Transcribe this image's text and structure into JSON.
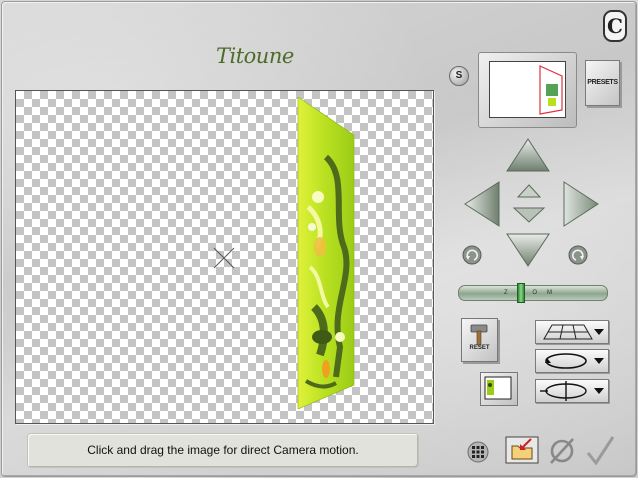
{
  "window": {
    "title": "Titoune",
    "logo_letter": "C"
  },
  "preview": {
    "status_text": "Click and drag the image for direct Camera motion."
  },
  "controls": {
    "s_label": "S",
    "presets_label": "PRESETS",
    "reset_label": "RESET",
    "zoom_label": "ZOOM"
  },
  "colors": {
    "title_green": "#4e6b2a",
    "image_lime": "#b8e020",
    "image_dark": "#4d6b1a",
    "image_orange": "#f0a020",
    "zoom_thumb": "#2e8b2e"
  },
  "icons": {
    "nav": [
      "arrow-up-icon",
      "arrow-left-icon",
      "arrow-right-icon",
      "arrow-down-icon",
      "move-forward-icon",
      "move-back-icon"
    ],
    "rotate": [
      "rotate-left-icon",
      "rotate-right-icon"
    ],
    "modes": [
      "perspective-grid-icon",
      "rotate-loop-icon",
      "spin-axis-icon"
    ],
    "bottom": [
      "grid-icon",
      "open-folder-icon",
      "cancel-icon",
      "ok-check-icon"
    ]
  }
}
